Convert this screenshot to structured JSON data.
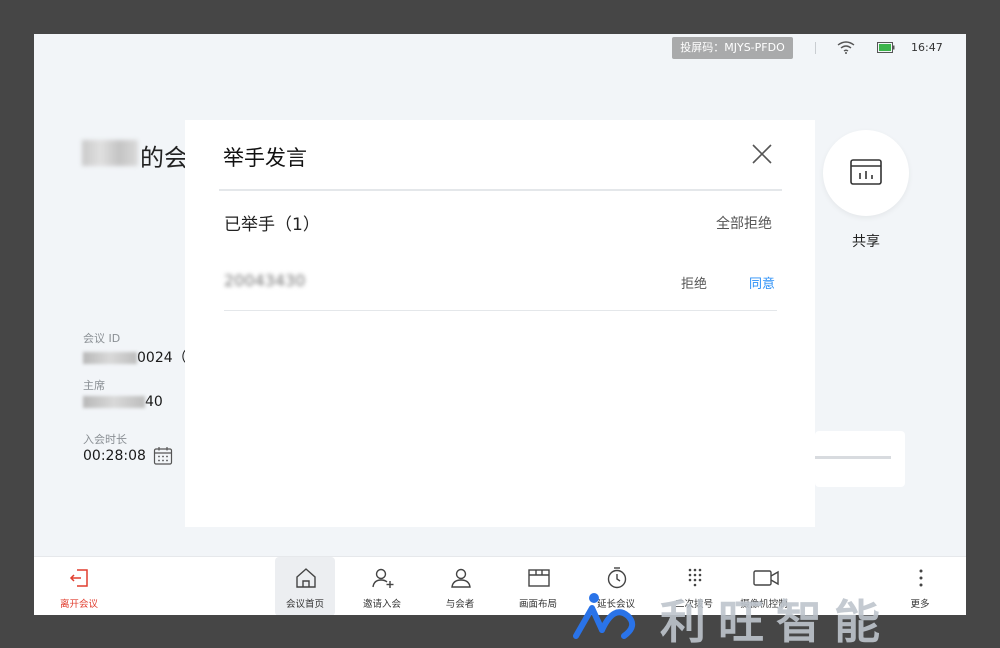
{
  "status_bar": {
    "cast_code": "投屏码：MJYS-PFDO",
    "time": "16:47"
  },
  "meeting": {
    "title_suffix": "的会",
    "id_label": "会议 ID",
    "id_value_suffix": "0024（",
    "host_label": "主席",
    "host_value_suffix": "40",
    "duration_label": "入会时长",
    "duration_value": "00:28:08"
  },
  "share": {
    "label": "共享"
  },
  "modal": {
    "title": "举手发言",
    "section_title": "已举手（1）",
    "reject_all": "全部拒绝",
    "participants": [
      {
        "name": "20043430",
        "reject": "拒绝",
        "accept": "同意"
      }
    ]
  },
  "toolbar": {
    "leave": "离开会议",
    "home": "会议首页",
    "invite": "邀请入会",
    "participants": "与会者",
    "layout": "画面布局",
    "extend": "延长会议",
    "dialpad": "二次拨号",
    "camera": "摄像机控制",
    "more": "更多"
  },
  "watermark": {
    "text": "利旺智能"
  },
  "colors": {
    "accent": "#2a8ff7",
    "danger": "#e13d2e",
    "background": "#f2f5f8"
  }
}
